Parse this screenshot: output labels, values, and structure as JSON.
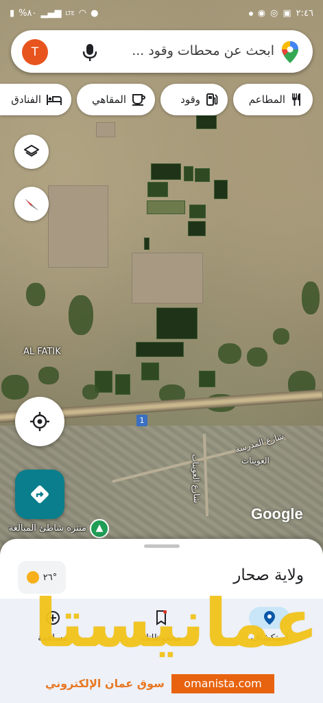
{
  "status_bar": {
    "time": "٢:٤٦",
    "battery": "%٨٠",
    "network": "LTE"
  },
  "search": {
    "placeholder": "ابحث عن محطات وقود ...",
    "avatar_letter": "T"
  },
  "chips": [
    {
      "label": "المطاعم",
      "icon": "fork-knife-icon"
    },
    {
      "label": "وقود",
      "icon": "fuel-icon"
    },
    {
      "label": "المقاهي",
      "icon": "coffee-icon"
    },
    {
      "label": "الفنادق",
      "icon": "bed-icon"
    }
  ],
  "map": {
    "place_label_fatik": "AL FATIK",
    "road_number": "1",
    "street_madrasa": "شارع المدرسة",
    "street_awaynat": "شارع العوينات",
    "area_awaynat": "العوينات",
    "park_label": "منتزه شاطئ المبالغة",
    "attribution": "Google"
  },
  "sheet": {
    "temperature": "٢٦°",
    "title": "ولاية صحار"
  },
  "nav": [
    {
      "label": "استكشاف",
      "icon": "explore-pin-icon",
      "active": true
    },
    {
      "label": "محفوظاتك",
      "icon": "bookmark-icon",
      "active": false
    },
    {
      "label": "مساهمة",
      "icon": "add-circle-icon",
      "active": false
    }
  ],
  "watermark": {
    "brand_ar": "عمانيستا",
    "tagline_ar": "سوق عمان الإلكتروني",
    "url": "omanista.com"
  },
  "colors": {
    "accent_teal": "#0a7e8c",
    "avatar_orange": "#e8541e",
    "watermark_yellow": "#f2c319",
    "watermark_orange": "#e8630f"
  }
}
